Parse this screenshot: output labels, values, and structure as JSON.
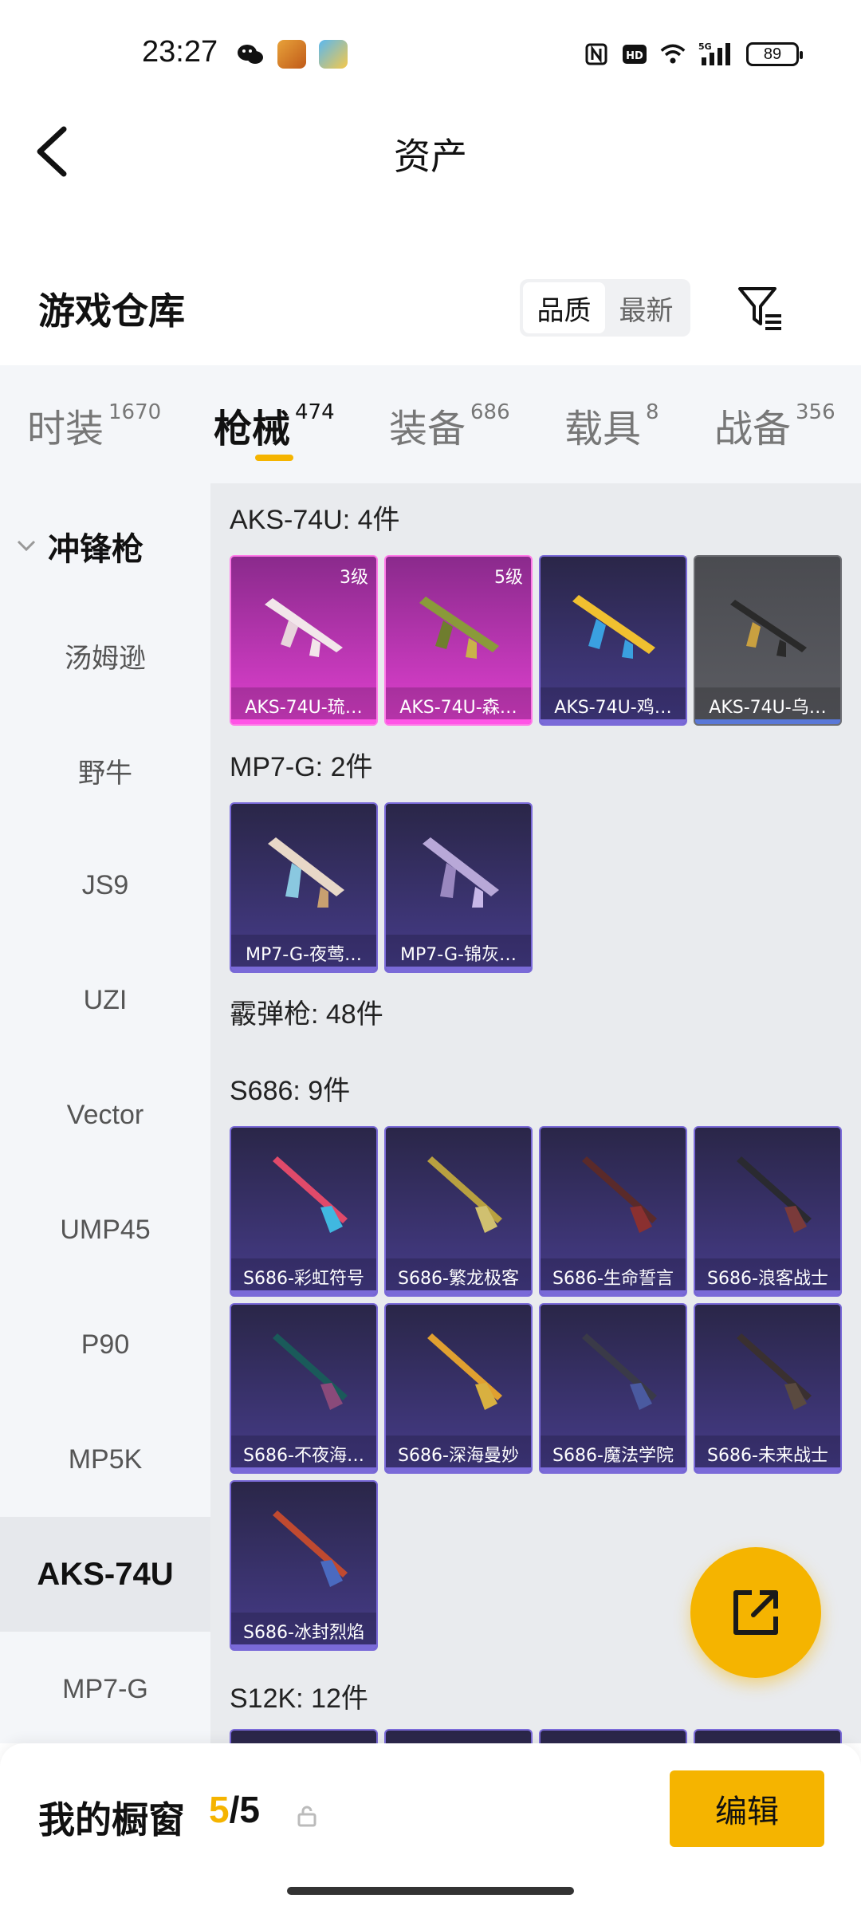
{
  "status_bar": {
    "time": "23:27",
    "battery": "89",
    "icons": [
      "wechat-icon",
      "app-icon",
      "weather-icon",
      "nfc-icon",
      "hd-icon",
      "wifi-icon",
      "signal-5g-icon"
    ]
  },
  "header": {
    "title": "资产"
  },
  "warehouse": {
    "title": "游戏仓库",
    "sort_options": [
      "品质",
      "最新"
    ],
    "sort_active": "品质"
  },
  "tabs": [
    {
      "label": "时装",
      "count": "1670"
    },
    {
      "label": "枪械",
      "count": "474",
      "active": true
    },
    {
      "label": "装备",
      "count": "686"
    },
    {
      "label": "载具",
      "count": "8"
    },
    {
      "label": "战备",
      "count": "356"
    }
  ],
  "sidebar": {
    "group": "冲锋枪",
    "items": [
      "汤姆逊",
      "野牛",
      "JS9",
      "UZI",
      "Vector",
      "UMP45",
      "P90",
      "MP5K",
      "AKS-74U",
      "MP7-G"
    ],
    "active": "AKS-74U"
  },
  "sections": [
    {
      "title": "AKS-74U: 4件",
      "cards": [
        {
          "name": "AKS-74U-琉…",
          "level": "3级",
          "rarity": "pink"
        },
        {
          "name": "AKS-74U-森…",
          "level": "5级",
          "rarity": "pink"
        },
        {
          "name": "AKS-74U-鸡…",
          "level": "",
          "rarity": "purple"
        },
        {
          "name": "AKS-74U-乌…",
          "level": "",
          "rarity": "gray"
        }
      ]
    },
    {
      "title": "MP7-G: 2件",
      "cards": [
        {
          "name": "MP7-G-夜莺…",
          "level": "",
          "rarity": "purple"
        },
        {
          "name": "MP7-G-锦灰…",
          "level": "",
          "rarity": "purple"
        }
      ]
    },
    {
      "title": "霰弹枪: 48件",
      "cards": []
    },
    {
      "title": "S686: 9件",
      "cards": [
        {
          "name": "S686-彩虹符号",
          "level": "",
          "rarity": "purple"
        },
        {
          "name": "S686-繁龙极客",
          "level": "",
          "rarity": "purple"
        },
        {
          "name": "S686-生命誓言",
          "level": "",
          "rarity": "purple"
        },
        {
          "name": "S686-浪客战士",
          "level": "",
          "rarity": "purple"
        },
        {
          "name": "S686-不夜海…",
          "level": "",
          "rarity": "purple"
        },
        {
          "name": "S686-深海曼妙",
          "level": "",
          "rarity": "purple"
        },
        {
          "name": "S686-魔法学院",
          "level": "",
          "rarity": "purple"
        },
        {
          "name": "S686-未来战士",
          "level": "",
          "rarity": "purple"
        },
        {
          "name": "S686-冰封烈焰",
          "level": "",
          "rarity": "purple"
        }
      ]
    },
    {
      "title": "S12K: 12件",
      "cards": []
    }
  ],
  "showcase": {
    "label": "我的橱窗",
    "current": "5",
    "separator": "/",
    "total": "5",
    "edit_label": "编辑"
  },
  "colors": {
    "accent": "#f5b400",
    "purple": "#463c8a",
    "pink": "#e040d0"
  }
}
